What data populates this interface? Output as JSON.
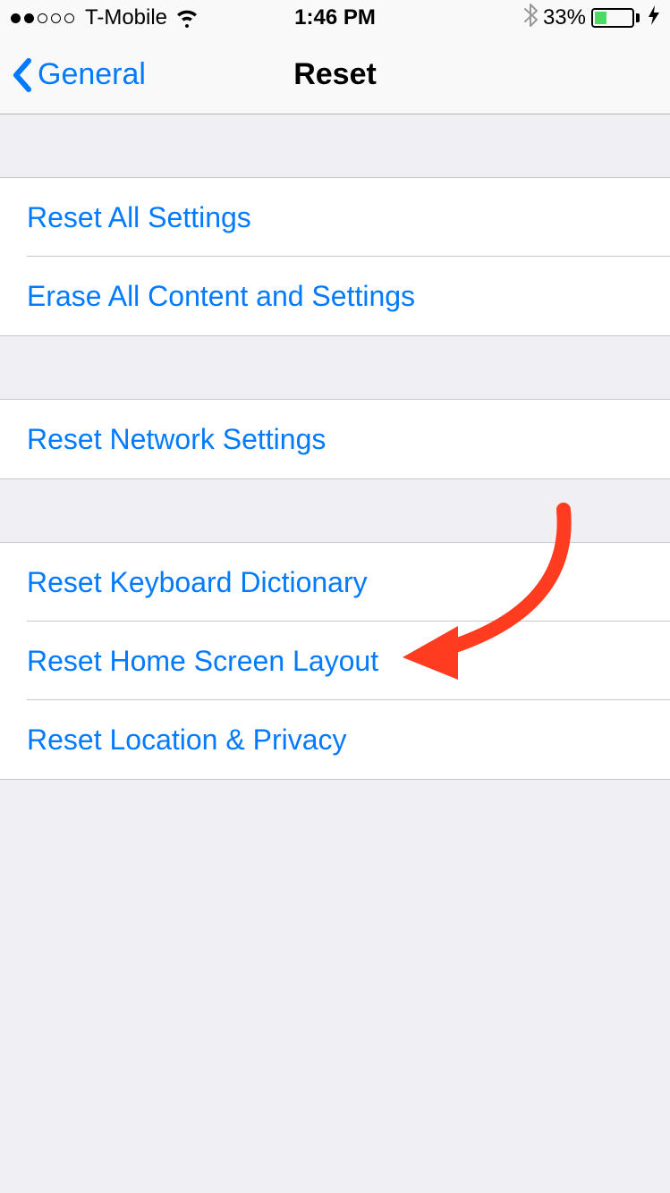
{
  "status_bar": {
    "carrier": "T-Mobile",
    "time": "1:46 PM",
    "battery_percent": "33%"
  },
  "nav": {
    "back_label": "General",
    "title": "Reset"
  },
  "groups": [
    {
      "items": [
        {
          "label": "Reset All Settings"
        },
        {
          "label": "Erase All Content and Settings"
        }
      ]
    },
    {
      "items": [
        {
          "label": "Reset Network Settings"
        }
      ]
    },
    {
      "items": [
        {
          "label": "Reset Keyboard Dictionary"
        },
        {
          "label": "Reset Home Screen Layout"
        },
        {
          "label": "Reset Location & Privacy"
        }
      ]
    }
  ]
}
